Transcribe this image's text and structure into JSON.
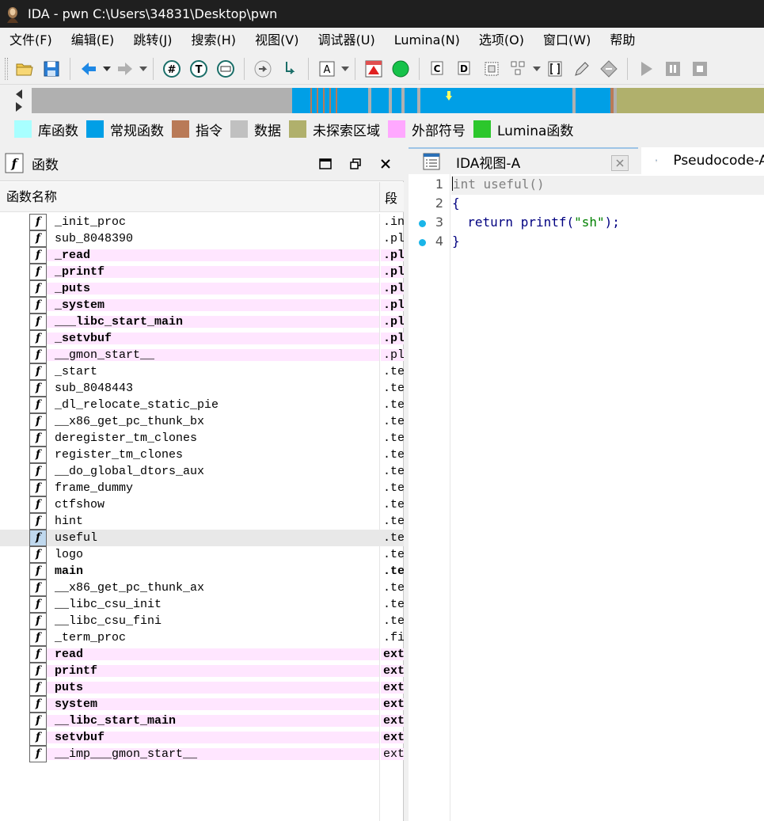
{
  "window": {
    "title": "IDA - pwn C:\\Users\\34831\\Desktop\\pwn"
  },
  "menu": [
    "文件(F)",
    "编辑(E)",
    "跳转(J)",
    "搜索(H)",
    "视图(V)",
    "调试器(U)",
    "Lumina(N)",
    "选项(O)",
    "窗口(W)",
    "帮助"
  ],
  "toolbar": {
    "buttons": [
      {
        "icon": "open-folder-icon"
      },
      {
        "icon": "save-icon"
      },
      {
        "icon": "back-arrow-icon"
      },
      {
        "icon": "forward-arrow-icon"
      },
      {
        "icon": "hex-view-icon"
      },
      {
        "icon": "text-view-icon"
      },
      {
        "icon": "binary-view-icon"
      },
      {
        "icon": "jump-out-icon"
      },
      {
        "icon": "jump-down-icon"
      },
      {
        "icon": "string-icon"
      },
      {
        "icon": "color-triangle-icon"
      },
      {
        "icon": "green-circle-icon"
      },
      {
        "icon": "code-icon"
      },
      {
        "icon": "data-icon"
      },
      {
        "icon": "struct-icon"
      },
      {
        "icon": "graph-icon"
      },
      {
        "icon": "bracket-icon"
      },
      {
        "icon": "edit-icon"
      },
      {
        "icon": "diamond-icon"
      },
      {
        "icon": "play-icon"
      },
      {
        "icon": "pause-icon"
      },
      {
        "icon": "stop-icon"
      }
    ]
  },
  "navband": {
    "colors": {
      "library": "#a8ffff",
      "regular": "#009fe6",
      "instruction": "#b97a57",
      "data": "#c0c0c0",
      "unexplored": "#b0b06c",
      "external": "#ffa8ff",
      "lumina": "#2cc72c"
    }
  },
  "legend": [
    {
      "label": "库函数",
      "color": "#a8ffff"
    },
    {
      "label": "常规函数",
      "color": "#009fe6"
    },
    {
      "label": "指令",
      "color": "#b97a57"
    },
    {
      "label": "数据",
      "color": "#c0c0c0"
    },
    {
      "label": "未探索区域",
      "color": "#b0b06c"
    },
    {
      "label": "外部符号",
      "color": "#ffa8ff"
    },
    {
      "label": "Lumina函数",
      "color": "#2cc72c"
    }
  ],
  "functions_panel": {
    "title": "函数",
    "col_name": "函数名称",
    "col_segment": "段",
    "rows": [
      {
        "name": "_init_proc",
        "segment": ".init",
        "bold": false,
        "extern": false
      },
      {
        "name": "sub_8048390",
        "segment": ".plt",
        "bold": false,
        "extern": false
      },
      {
        "name": "_read",
        "segment": ".plt",
        "bold": true,
        "extern": true
      },
      {
        "name": "_printf",
        "segment": ".plt",
        "bold": true,
        "extern": true
      },
      {
        "name": "_puts",
        "segment": ".plt",
        "bold": true,
        "extern": true
      },
      {
        "name": "_system",
        "segment": ".plt",
        "bold": true,
        "extern": true
      },
      {
        "name": "___libc_start_main",
        "segment": ".plt",
        "bold": true,
        "extern": true
      },
      {
        "name": "_setvbuf",
        "segment": ".plt",
        "bold": true,
        "extern": true
      },
      {
        "name": "__gmon_start__",
        "segment": ".plt",
        "bold": false,
        "extern": true
      },
      {
        "name": "_start",
        "segment": ".text",
        "bold": false,
        "extern": false
      },
      {
        "name": "sub_8048443",
        "segment": ".text",
        "bold": false,
        "extern": false
      },
      {
        "name": "_dl_relocate_static_pie",
        "segment": ".text",
        "bold": false,
        "extern": false
      },
      {
        "name": "__x86_get_pc_thunk_bx",
        "segment": ".text",
        "bold": false,
        "extern": false
      },
      {
        "name": "deregister_tm_clones",
        "segment": ".text",
        "bold": false,
        "extern": false
      },
      {
        "name": "register_tm_clones",
        "segment": ".text",
        "bold": false,
        "extern": false
      },
      {
        "name": "__do_global_dtors_aux",
        "segment": ".text",
        "bold": false,
        "extern": false
      },
      {
        "name": "frame_dummy",
        "segment": ".text",
        "bold": false,
        "extern": false
      },
      {
        "name": "ctfshow",
        "segment": ".text",
        "bold": false,
        "extern": false
      },
      {
        "name": "hint",
        "segment": ".text",
        "bold": false,
        "extern": false
      },
      {
        "name": "useful",
        "segment": ".text",
        "bold": false,
        "extern": false,
        "selected": true
      },
      {
        "name": "logo",
        "segment": ".text",
        "bold": false,
        "extern": false
      },
      {
        "name": "main",
        "segment": ".text",
        "bold": true,
        "extern": false
      },
      {
        "name": "__x86_get_pc_thunk_ax",
        "segment": ".text",
        "bold": false,
        "extern": false
      },
      {
        "name": "__libc_csu_init",
        "segment": ".text",
        "bold": false,
        "extern": false
      },
      {
        "name": "__libc_csu_fini",
        "segment": ".text",
        "bold": false,
        "extern": false
      },
      {
        "name": "_term_proc",
        "segment": ".fini",
        "bold": false,
        "extern": false
      },
      {
        "name": "read",
        "segment": "extern",
        "bold": true,
        "extern": true
      },
      {
        "name": "printf",
        "segment": "extern",
        "bold": true,
        "extern": true
      },
      {
        "name": "puts",
        "segment": "extern",
        "bold": true,
        "extern": true
      },
      {
        "name": "system",
        "segment": "extern",
        "bold": true,
        "extern": true
      },
      {
        "name": "__libc_start_main",
        "segment": "extern",
        "bold": true,
        "extern": true
      },
      {
        "name": "setvbuf",
        "segment": "extern",
        "bold": true,
        "extern": true
      },
      {
        "name": "__imp___gmon_start__",
        "segment": "extern",
        "bold": false,
        "extern": true
      }
    ]
  },
  "tabs": [
    {
      "label": "IDA视图-A",
      "active": true
    },
    {
      "label": "Pseudocode-A",
      "active": false
    }
  ],
  "code": {
    "lines": [
      {
        "num": "1",
        "text": "int useful()",
        "breakpoint": false
      },
      {
        "num": "2",
        "text": "{",
        "breakpoint": false
      },
      {
        "num": "3",
        "text": "  return printf(\"sh\");",
        "breakpoint": true
      },
      {
        "num": "4",
        "text": "}",
        "breakpoint": true
      }
    ]
  }
}
